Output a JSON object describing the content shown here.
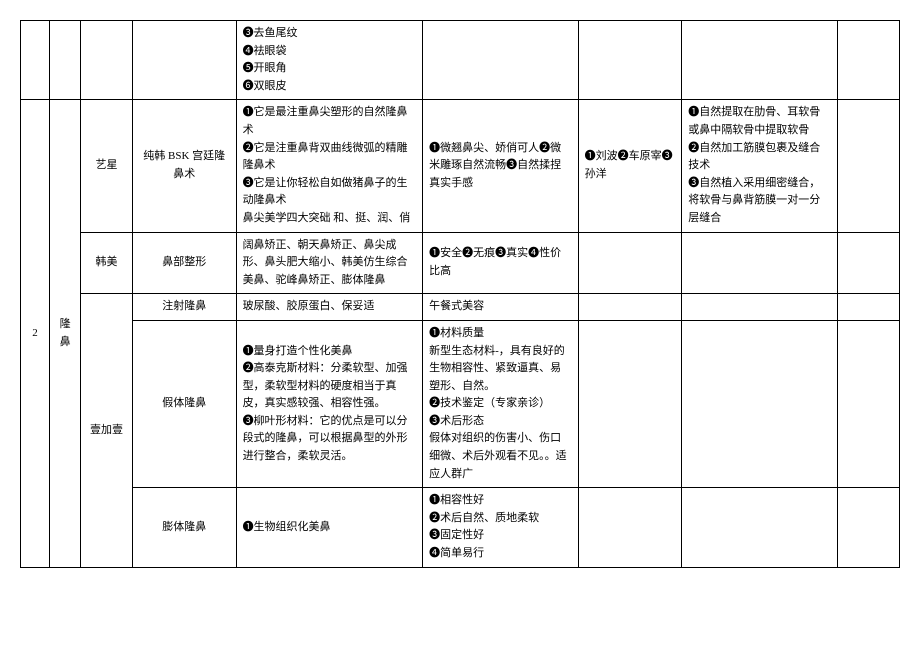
{
  "row0": {
    "c4": "❸去鱼尾纹\n❹祛眼袋\n❺开眼角\n❻双眼皮"
  },
  "index": "2",
  "category": "隆鼻",
  "r1": {
    "brand": "艺星",
    "name": "纯韩 BSK 宫廷隆鼻术",
    "c4": "❶它是最注重鼻尖塑形的自然隆鼻术\n❷它是注重鼻背双曲线微弧的精雕隆鼻术\n❸它是让你轻松自如做猪鼻子的生动隆鼻术\n鼻尖美学四大突础 和、挺、润、俏",
    "c5": "❶微翘鼻尖、娇俏可人❷微米雕琢自然流畅❸自然揉捏真实手感",
    "c6": "❶刘波❷车原宰❸孙洋",
    "c7": "❶自然提取在肋骨、耳软骨或鼻中隔软骨中提取软骨\n❷自然加工筋膜包裹及缝合技术\n❸自然植入采用细密缝合，将软骨与鼻背筋膜一对一分层缝合"
  },
  "r2": {
    "brand": "韩美",
    "name": "鼻部整形",
    "c4": "阔鼻矫正、朝天鼻矫正、鼻尖成形、鼻头肥大缩小、韩美仿生综合美鼻、驼峰鼻矫正、膨体隆鼻",
    "c5": "❶安全❷无痕❸真实❹性价比高"
  },
  "r3": {
    "brand": "壹加壹",
    "name": "注射隆鼻",
    "c4": "玻尿酸、胶原蛋白、保妥适",
    "c5": "午餐式美容"
  },
  "r4": {
    "name": "假体隆鼻",
    "c4": "❶量身打造个性化美鼻\n❷高泰克斯材料：分柔软型、加强型，柔软型材料的硬度相当于真皮，真实感较强、相容性强。\n❸柳叶形材料：它的优点是可以分段式的隆鼻，可以根据鼻型的外形进行整合，柔软灵活。",
    "c5": "❶材料质量\n新型生态材料-，具有良好的生物相容性、紧致逼真、易塑形、自然。\n❷技术鉴定（专家亲诊）\n❸术后形态\n假体对组织的伤害小、伤口细微、术后外观看不见。。适应人群广"
  },
  "r5": {
    "name": "膨体隆鼻",
    "c4": "❶生物组织化美鼻",
    "c5": "❶相容性好\n❷术后自然、质地柔软\n❸固定性好\n❹简单易行"
  }
}
